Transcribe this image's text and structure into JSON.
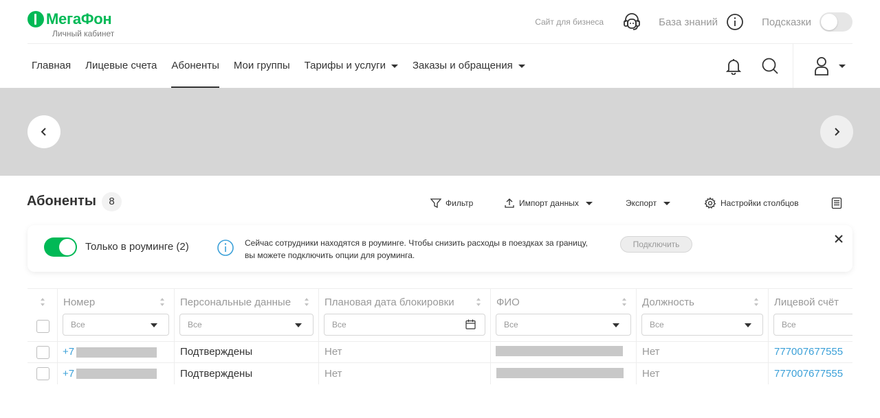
{
  "header": {
    "logo_text": "МегаФон",
    "logo_subtitle": "Личный кабинет",
    "business_link": "Сайт для бизнеса",
    "knowledge_base": "База знаний",
    "hints_label": "Подсказки",
    "hints_enabled": false
  },
  "nav": {
    "items": [
      {
        "label": "Главная",
        "active": false,
        "dropdown": false
      },
      {
        "label": "Лицевые счета",
        "active": false,
        "dropdown": false
      },
      {
        "label": "Абоненты",
        "active": true,
        "dropdown": false
      },
      {
        "label": "Мои группы",
        "active": false,
        "dropdown": false
      },
      {
        "label": "Тарифы и услуги",
        "active": false,
        "dropdown": true
      },
      {
        "label": "Заказы и обращения",
        "active": false,
        "dropdown": true
      }
    ],
    "icons": [
      "bell-icon",
      "search-icon",
      "user-icon",
      "chevron-down-icon"
    ]
  },
  "banner": {
    "prev_icon": "chevron-left-icon",
    "next_icon": "chevron-right-icon"
  },
  "section": {
    "title": "Абоненты",
    "count": "8",
    "toolbar": {
      "filter": "Фильтр",
      "import": "Импорт данных",
      "export": "Экспорт",
      "columns": "Настройки столбцов"
    }
  },
  "roaming": {
    "toggle_label": "Только в роуминге (2)",
    "toggle_on": true,
    "text_line1": "Сейчас сотрудники находятся в роуминге. Чтобы снизить расходы в поездках за границу,",
    "text_line2": "вы можете подключить опции для роуминга.",
    "connect": "Подключить"
  },
  "table": {
    "columns": [
      {
        "label": "Номер",
        "filter": "Все",
        "filter_type": "select"
      },
      {
        "label": "Персональные данные",
        "filter": "Все",
        "filter_type": "select"
      },
      {
        "label": "Плановая дата блокировки",
        "filter": "Все",
        "filter_type": "date"
      },
      {
        "label": "ФИО",
        "filter": "Все",
        "filter_type": "select"
      },
      {
        "label": "Должность",
        "filter": "Все",
        "filter_type": "select"
      },
      {
        "label": "Лицевой счёт",
        "filter": "Все",
        "filter_type": "select"
      }
    ],
    "rows": [
      {
        "phone_prefix": "+7",
        "personal_data": "Подтверждены",
        "block_date": "Нет",
        "position": "Нет",
        "account": "777007677555"
      },
      {
        "phone_prefix": "+7",
        "personal_data": "Подтверждены",
        "block_date": "Нет",
        "position": "Нет",
        "account": "777007677555"
      }
    ]
  },
  "colors": {
    "brand": "#00b956",
    "link": "#3ba0d8",
    "muted": "#999999",
    "text": "#333333"
  }
}
